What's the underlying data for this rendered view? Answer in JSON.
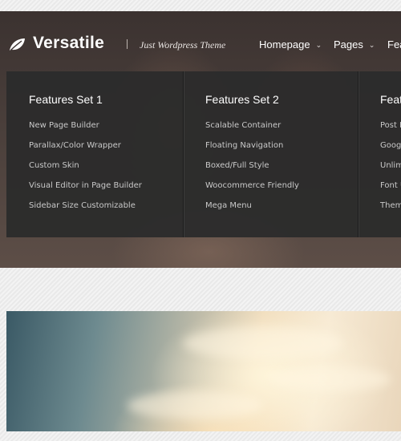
{
  "brand": {
    "name": "Versatile",
    "tagline": "Just Wordpress Theme",
    "icon": "leaf-icon"
  },
  "nav": [
    {
      "label": "Homepage",
      "icon": "chevron-down-icon"
    },
    {
      "label": "Pages",
      "icon": "chevron-down-icon"
    },
    {
      "label": "Fea"
    }
  ],
  "mega_menu": {
    "columns": [
      {
        "title": "Features Set 1",
        "items": [
          "New Page Builder",
          "Parallax/Color Wrapper",
          "Custom Skin",
          "Visual Editor in Page Builder",
          "Sidebar Size Customizable"
        ]
      },
      {
        "title": "Features Set 2",
        "items": [
          "Scalable Container",
          "Floating Navigation",
          "Boxed/Full Style",
          "Woocommerce Friendly",
          "Mega Menu"
        ]
      },
      {
        "title": "Feat",
        "items": [
          "Post F",
          "Googl",
          "Unlim",
          "Font U",
          "Them"
        ]
      }
    ]
  },
  "colors": {
    "menu_bg": "#2c2c2c",
    "text_light": "#ffffff",
    "item_text": "#c9c9c9"
  }
}
